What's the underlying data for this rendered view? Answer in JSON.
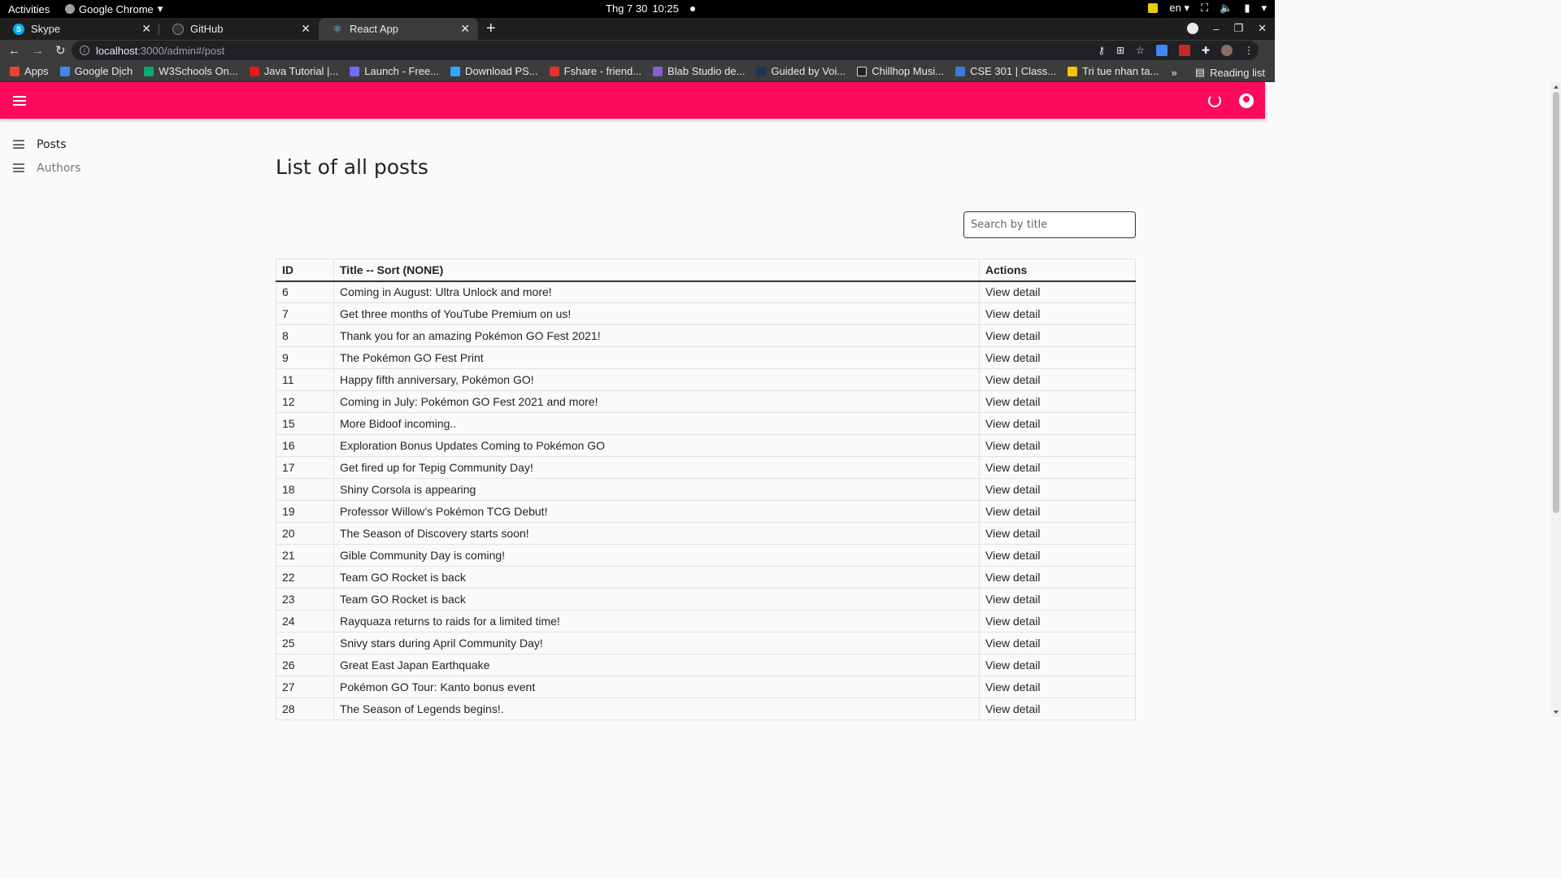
{
  "os": {
    "activities": "Activities",
    "app_name": "Google Chrome",
    "date": "Thg 7 30",
    "time": "10:25",
    "lang": "en"
  },
  "tabs": [
    {
      "label": "Skype",
      "icon": "skype-icon",
      "color": "#00aff0"
    },
    {
      "label": "GitHub",
      "icon": "github-icon",
      "color": "#333333"
    },
    {
      "label": "React App",
      "icon": "react-icon",
      "color": "#61dafb"
    }
  ],
  "omnibox": {
    "host": "localhost",
    "path": ":3000/admin#/post"
  },
  "bookmarks": [
    {
      "label": "Apps",
      "color": "#e94235"
    },
    {
      "label": "Google Dịch",
      "color": "#4285f4"
    },
    {
      "label": "W3Schools On...",
      "color": "#04aa6d"
    },
    {
      "label": "Java Tutorial |...",
      "color": "#e21b1b"
    },
    {
      "label": "Launch - Free...",
      "color": "#6c6cff"
    },
    {
      "label": "Download PS...",
      "color": "#31a8ff"
    },
    {
      "label": "Fshare - friend...",
      "color": "#e0322c"
    },
    {
      "label": "Blab Studio de...",
      "color": "#8a5cd1"
    },
    {
      "label": "Guided by Voi...",
      "color": "#1d3557"
    },
    {
      "label": "Chillhop Musi...",
      "color": "#222222"
    },
    {
      "label": "CSE 301 | Class...",
      "color": "#3a7bd5"
    },
    {
      "label": "Tri tue nhan ta...",
      "color": "#f4c20d"
    }
  ],
  "reading_list": "Reading list",
  "more_bookmarks": "»",
  "app": {
    "accent": "#ff0a5b",
    "menu": [
      {
        "label": "Posts"
      },
      {
        "label": "Authors"
      }
    ],
    "page_title": "List of all posts",
    "search_placeholder": "Search by title",
    "table": {
      "headers": [
        "ID",
        "Title -- Sort (NONE)",
        "Actions"
      ],
      "rows": [
        {
          "id": "6",
          "title": "Coming in August: Ultra Unlock and more!",
          "action": "View detail"
        },
        {
          "id": "7",
          "title": "Get three months of YouTube Premium on us!",
          "action": "View detail"
        },
        {
          "id": "8",
          "title": "Thank you for an amazing Pokémon GO Fest 2021!",
          "action": "View detail"
        },
        {
          "id": "9",
          "title": "The Pokémon GO Fest Print",
          "action": "View detail"
        },
        {
          "id": "11",
          "title": "Happy fifth anniversary, Pokémon GO!",
          "action": "View detail"
        },
        {
          "id": "12",
          "title": "Coming in July: Pokémon GO Fest 2021 and more!",
          "action": "View detail"
        },
        {
          "id": "15",
          "title": "More Bidoof incoming..",
          "action": "View detail"
        },
        {
          "id": "16",
          "title": "Exploration Bonus Updates Coming to Pokémon GO",
          "action": "View detail"
        },
        {
          "id": "17",
          "title": "Get fired up for Tepig Community Day!",
          "action": "View detail"
        },
        {
          "id": "18",
          "title": "Shiny Corsola is appearing",
          "action": "View detail"
        },
        {
          "id": "19",
          "title": "Professor Willow’s Pokémon TCG Debut!",
          "action": "View detail"
        },
        {
          "id": "20",
          "title": "The Season of Discovery starts soon!",
          "action": "View detail"
        },
        {
          "id": "21",
          "title": "Gible Community Day is coming!",
          "action": "View detail"
        },
        {
          "id": "22",
          "title": "Team GO Rocket is back",
          "action": "View detail"
        },
        {
          "id": "23",
          "title": "Team GO Rocket is back",
          "action": "View detail"
        },
        {
          "id": "24",
          "title": "Rayquaza returns to raids for a limited time!",
          "action": "View detail"
        },
        {
          "id": "25",
          "title": "Snivy stars during April Community Day!",
          "action": "View detail"
        },
        {
          "id": "26",
          "title": "Great East Japan Earthquake",
          "action": "View detail"
        },
        {
          "id": "27",
          "title": "Pokémon GO Tour: Kanto bonus event",
          "action": "View detail"
        },
        {
          "id": "28",
          "title": "The Season of Legends begins!.",
          "action": "View detail"
        }
      ]
    }
  }
}
